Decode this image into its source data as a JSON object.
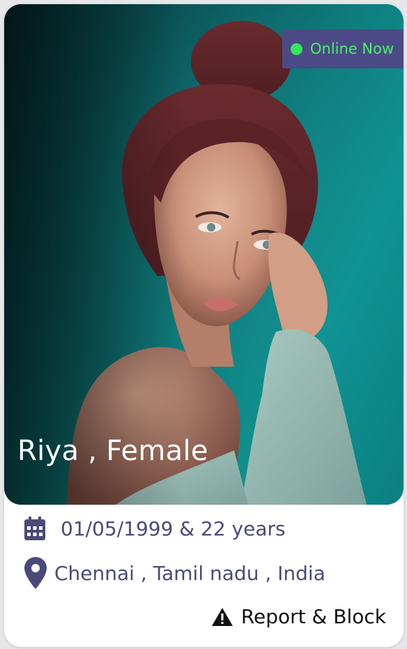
{
  "profile": {
    "name_line": "Riya , Female",
    "online_status": "Online Now",
    "dob_age": "01/05/1999 & 22 years",
    "location": "Chennai , Tamil nadu , India",
    "report_label": "Report & Block",
    "photo_alt": "profile-photo"
  },
  "icons": {
    "online": "online-dot-icon",
    "dob": "calendar-icon",
    "location": "map-pin-icon",
    "report": "warning-icon"
  },
  "colors": {
    "accent": "#4b4a86",
    "online_green": "#35e85a",
    "text_info": "#4a4a7a",
    "photo_background": "#0f7b7c"
  }
}
